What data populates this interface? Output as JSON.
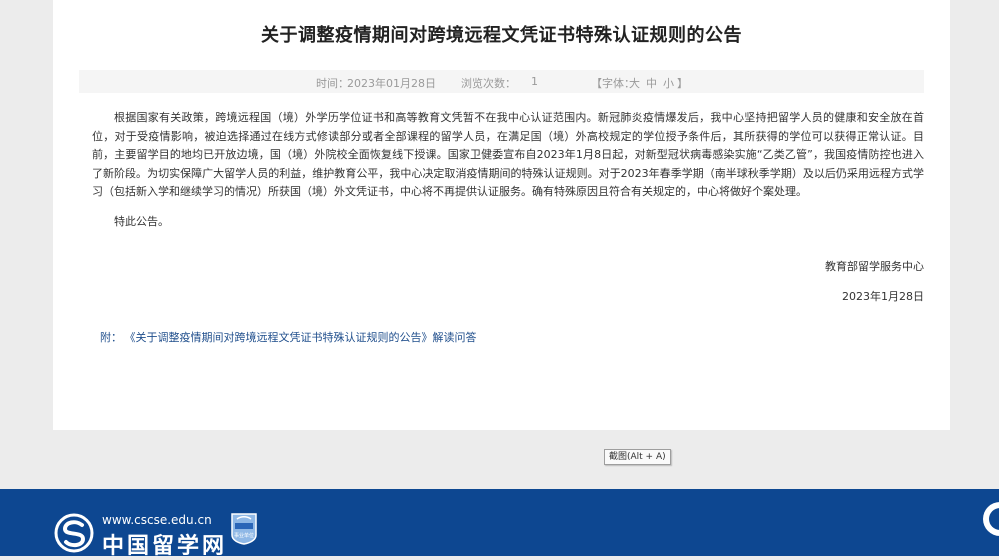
{
  "article": {
    "title": "关于调整疫情期间对跨境远程文凭证书特殊认证规则的公告",
    "meta": {
      "time_label": "时间：",
      "time_value": "2023年01月28日",
      "views_label": "浏览次数：",
      "views_value": "1",
      "font_label_open": "【字体：",
      "font_large": "大",
      "font_medium": "中",
      "font_small": "小",
      "font_label_close": "】"
    },
    "paragraphs": [
      "根据国家有关政策，跨境远程国（境）外学历学位证书和高等教育文凭暂不在我中心认证范围内。新冠肺炎疫情爆发后，我中心坚持把留学人员的健康和安全放在首位，对于受疫情影响，被迫选择通过在线方式修读部分或者全部课程的留学人员，在满足国（境）外高校规定的学位授予条件后，其所获得的学位可以获得正常认证。目前，主要留学目的地均已开放边境，国（境）外院校全面恢复线下授课。国家卫健委宣布自2023年1月8日起，对新型冠状病毒感染实施“乙类乙管”，我国疫情防控也进入了新阶段。为切实保障广大留学人员的利益，维护教育公平，我中心决定取消疫情期间的特殊认证规则。对于2023年春季学期（南半球秋季学期）及以后仍采用远程方式学习（包括新入学和继续学习的情况）所获国（境）外文凭证书，中心将不再提供认证服务。确有特殊原因且符合有关规定的，中心将做好个案处理。"
    ],
    "closing": "特此公告。",
    "signature": "教育部留学服务中心",
    "sign_date": "2023年1月28日",
    "attachment": {
      "label": "附：",
      "link_text": "《关于调整疫情期间对跨境远程文凭证书特殊认证规则的公告》解读问答"
    }
  },
  "screenshot_tip": "截图(Alt + A)",
  "footer": {
    "url": "www.cscse.edu.cn",
    "brand": "中国留学网",
    "badge_text": "事业单位",
    "background_color": "#0d4791",
    "logo_icon": "cscse-logo-icon",
    "badge_icon": "public-institution-badge-icon"
  },
  "colors": {
    "page_background": "#ececec",
    "card_background": "#ffffff",
    "link": "#1f4e8c",
    "meta_text": "#9a9a9a"
  }
}
